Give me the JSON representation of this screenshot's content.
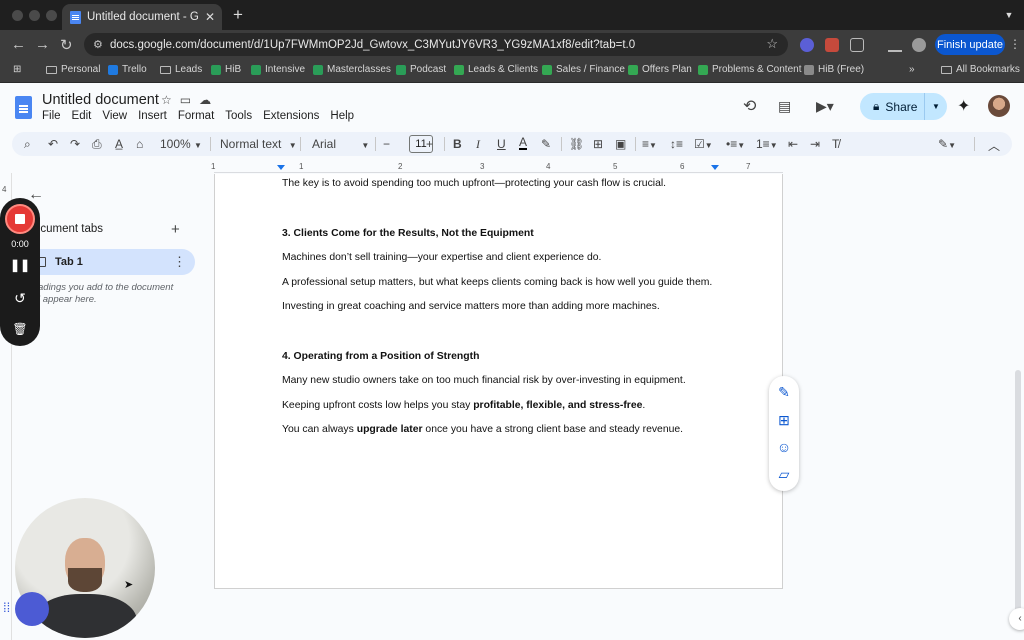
{
  "browser": {
    "tab_title": "Untitled document - Google D",
    "tab_close": "✕",
    "new_tab": "+",
    "url": "docs.google.com/document/d/1Up7FWMmOP2Jd_Gwtovx_C3MYutJY6VR3_YG9zMA1xf8/edit?tab=t.0",
    "finish_update_label": "Finish update",
    "bookmarks": [
      "Personal",
      "Trello",
      "Leads",
      "HiB",
      "Intensive",
      "Masterclasses",
      "Podcast",
      "Leads & Clients",
      "Sales / Finance",
      "Offers Plan",
      "Problems & Content",
      "HiB (Free)"
    ],
    "bookmark_overflow": "»",
    "all_bookmarks_label": "All Bookmarks"
  },
  "docs": {
    "title": "Untitled document",
    "menu": [
      "File",
      "Edit",
      "View",
      "Insert",
      "Format",
      "Tools",
      "Extensions",
      "Help"
    ],
    "share_label": "Share"
  },
  "toolbar": {
    "zoom": "100%",
    "style": "Normal text",
    "font": "Arial",
    "font_size": "11"
  },
  "ruler": {
    "numbers": [
      "1",
      "1",
      "2",
      "3",
      "4",
      "5",
      "6",
      "7"
    ]
  },
  "side_panel": {
    "heading": "ocument tabs",
    "tab_label": "Tab 1",
    "hint": "adings you add to the document\nl appear here."
  },
  "recorder": {
    "time": "0:00"
  },
  "document": {
    "line1": "The key is to avoid spending too much upfront—protecting your cash flow is crucial.",
    "heading3": "3. Clients Come for the Results, Not the Equipment",
    "line2": "Machines don’t sell training—your expertise and client experience do.",
    "line3": "A professional setup matters, but what keeps clients coming back is how well you guide them.",
    "line4": "Investing in great coaching and service matters more than adding more machines.",
    "heading4": "4. Operating from a Position of Strength",
    "line5": "Many new studio owners take on too much financial risk by over-investing in equipment.",
    "line6_pre": "Keeping upfront costs low helps you stay ",
    "line6_bold": "profitable, flexible, and stress-free",
    "line6_post": ".",
    "line7_pre": "You can always ",
    "line7_bold": "upgrade later",
    "line7_post": " once you have a strong client base and steady revenue."
  },
  "colors": {
    "accent": "#0b57d0",
    "share_bg": "#c2e7ff",
    "record_red": "#e53935"
  }
}
